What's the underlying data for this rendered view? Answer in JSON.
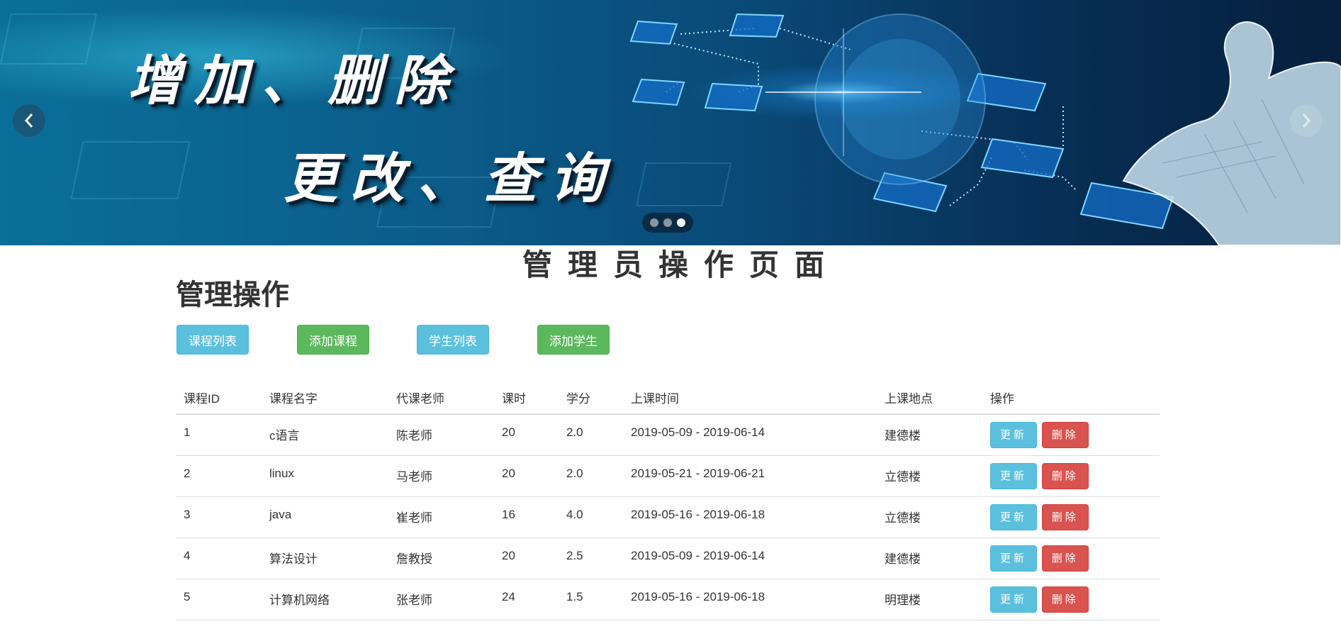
{
  "banner": {
    "slogan_line1": "增加、删除",
    "slogan_line2": "更改、查询",
    "prev_icon": "chevron-left-icon",
    "next_icon": "chevron-right-icon",
    "active_slide": 3,
    "slide_count": 3
  },
  "page_title": "管理员操作页面",
  "section_title": "管理操作",
  "actions": [
    {
      "label": "课程列表",
      "style": "info"
    },
    {
      "label": "添加课程",
      "style": "success"
    },
    {
      "label": "学生列表",
      "style": "info"
    },
    {
      "label": "添加学生",
      "style": "success"
    }
  ],
  "table": {
    "headers": [
      "课程ID",
      "课程名字",
      "代课老师",
      "课时",
      "学分",
      "上课时间",
      "上课地点",
      "操作"
    ],
    "rows": [
      [
        "1",
        "c语言",
        "陈老师",
        "20",
        "2.0",
        "2019-05-09 - 2019-06-14",
        "建德楼"
      ],
      [
        "2",
        "linux",
        "马老师",
        "20",
        "2.0",
        "2019-05-21 - 2019-06-21",
        "立德楼"
      ],
      [
        "3",
        "java",
        "崔老师",
        "16",
        "4.0",
        "2019-05-16 - 2019-06-18",
        "立德楼"
      ],
      [
        "4",
        "算法设计",
        "詹教授",
        "20",
        "2.5",
        "2019-05-09 - 2019-06-14",
        "建德楼"
      ],
      [
        "5",
        "计算机网络",
        "张老师",
        "24",
        "1.5",
        "2019-05-16 - 2019-06-18",
        "明理楼"
      ]
    ],
    "update_label": "更新",
    "delete_label": "删除"
  },
  "colors": {
    "info": "#5bc0de",
    "success": "#5cb85c",
    "danger": "#d9534f",
    "text": "#333333"
  }
}
